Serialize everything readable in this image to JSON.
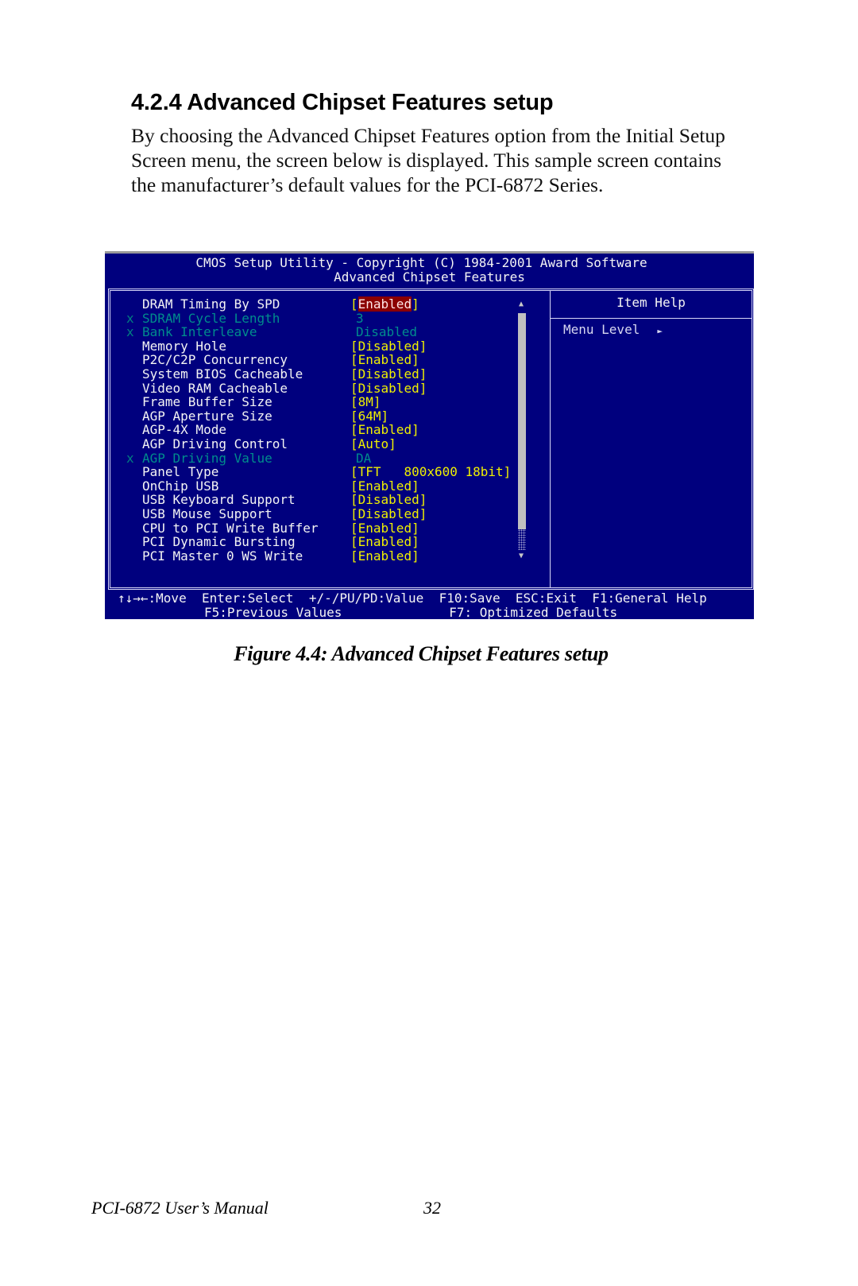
{
  "document": {
    "heading": "4.2.4 Advanced Chipset Features setup",
    "body_lines": [
      "By choosing the Advanced Chipset Features option from the Initial Setup",
      "Screen menu, the screen below is displayed. This sample screen contains",
      "the manufacturer’s default values for the PCI-6872 Series."
    ],
    "figure_caption": "Figure 4.4: Advanced Chipset Features setup",
    "footer_title": "PCI-6872 User’s Manual",
    "page_number": "32"
  },
  "bios": {
    "title_line1": "CMOS Setup Utility - Copyright (C) 1984-2001 Award Software",
    "title_line2": "Advanced Chipset Features",
    "colors": {
      "background": "#00007e",
      "label": "#f4f4f4",
      "value": "#f0f000",
      "disabled": "#008c8c",
      "highlight": "#8b0000"
    },
    "items": [
      {
        "mark": "",
        "label": "DRAM Timing By SPD",
        "value_open": "[",
        "value": "Enabled",
        "value_close": "]",
        "state": "selected"
      },
      {
        "mark": "x",
        "label": "SDRAM Cycle Length",
        "value_open": "",
        "value": "3",
        "value_close": "",
        "state": "disabled"
      },
      {
        "mark": "x",
        "label": "Bank Interleave",
        "value_open": "",
        "value": "Disabled",
        "value_close": "",
        "state": "disabled"
      },
      {
        "mark": "",
        "label": "Memory Hole",
        "value_open": "[",
        "value": "Disabled",
        "value_close": "]",
        "state": "normal"
      },
      {
        "mark": "",
        "label": "P2C/C2P Concurrency",
        "value_open": "[",
        "value": "Enabled",
        "value_close": "]",
        "state": "normal"
      },
      {
        "mark": "",
        "label": "System BIOS Cacheable",
        "value_open": "[",
        "value": "Disabled",
        "value_close": "]",
        "state": "normal"
      },
      {
        "mark": "",
        "label": "Video RAM Cacheable",
        "value_open": "[",
        "value": "Disabled",
        "value_close": "]",
        "state": "normal"
      },
      {
        "mark": "",
        "label": "Frame Buffer Size",
        "value_open": "[",
        "value": "8M",
        "value_close": "]",
        "state": "normal"
      },
      {
        "mark": "",
        "label": "AGP Aperture Size",
        "value_open": "[",
        "value": "64M",
        "value_close": "]",
        "state": "normal"
      },
      {
        "mark": "",
        "label": "AGP-4X Mode",
        "value_open": "[",
        "value": "Enabled",
        "value_close": "]",
        "state": "normal"
      },
      {
        "mark": "",
        "label": "AGP Driving Control",
        "value_open": "[",
        "value": "Auto",
        "value_close": "]",
        "state": "normal"
      },
      {
        "mark": "x",
        "label": "AGP Driving Value",
        "value_open": "",
        "value": "DA",
        "value_close": "",
        "state": "disabled"
      },
      {
        "mark": "",
        "label": "Panel Type",
        "value_open": "[",
        "value": "TFT   800x600 18bit",
        "value_close": "]",
        "state": "normal"
      },
      {
        "mark": "",
        "label": "OnChip USB",
        "value_open": "[",
        "value": "Enabled",
        "value_close": "]",
        "state": "normal"
      },
      {
        "mark": "",
        "label": "USB Keyboard Support",
        "value_open": "[",
        "value": "Disabled",
        "value_close": "]",
        "state": "normal"
      },
      {
        "mark": "",
        "label": "USB Mouse Support",
        "value_open": "[",
        "value": "Disabled",
        "value_close": "]",
        "state": "normal"
      },
      {
        "mark": "",
        "label": "CPU to PCI Write Buffer",
        "value_open": "[",
        "value": "Enabled",
        "value_close": "]",
        "state": "normal"
      },
      {
        "mark": "",
        "label": "PCI Dynamic Bursting",
        "value_open": "[",
        "value": "Enabled",
        "value_close": "]",
        "state": "normal"
      },
      {
        "mark": "",
        "label": "PCI Master 0 WS Write",
        "value_open": "[",
        "value": "Enabled",
        "value_close": "]",
        "state": "normal"
      }
    ],
    "scrollbar": {
      "up_icon": "▲",
      "down_icon": "▼",
      "thumb_fraction": 0.9
    },
    "help": {
      "title": "Item Help",
      "menu_level_label": "Menu Level",
      "menu_level_icon": "►"
    },
    "keys_line1": "↑↓→←:Move  Enter:Select  +/-/PU/PD:Value  F10:Save  ESC:Exit  F1:General Help",
    "keys_line2": "F5:Previous Values              F7: Optimized Defaults"
  }
}
